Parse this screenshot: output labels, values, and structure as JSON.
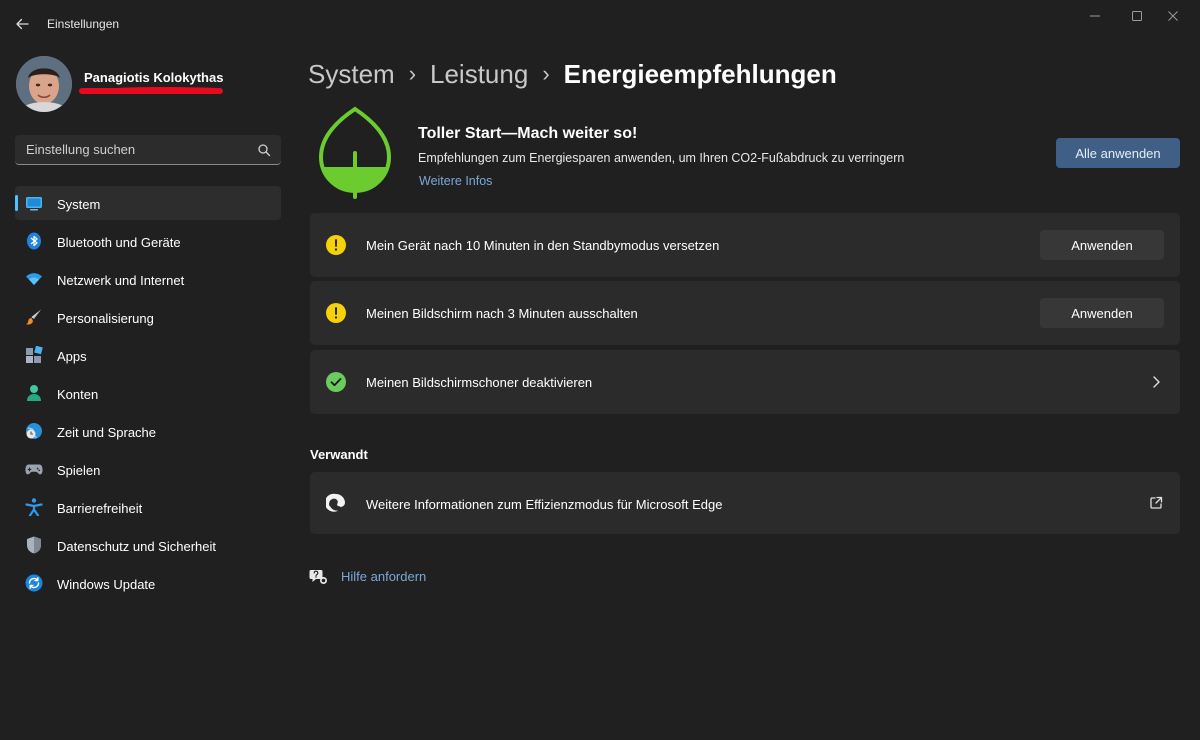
{
  "window": {
    "title": "Einstellungen"
  },
  "profile": {
    "name": "Panagiotis Kolokythas"
  },
  "search": {
    "placeholder": "Einstellung suchen"
  },
  "sidebar": {
    "items": [
      {
        "label": "System",
        "icon": "monitor-icon",
        "active": true
      },
      {
        "label": "Bluetooth und Geräte",
        "icon": "bluetooth-icon"
      },
      {
        "label": "Netzwerk und Internet",
        "icon": "wifi-icon"
      },
      {
        "label": "Personalisierung",
        "icon": "paintbrush-icon"
      },
      {
        "label": "Apps",
        "icon": "apps-icon"
      },
      {
        "label": "Konten",
        "icon": "person-icon"
      },
      {
        "label": "Zeit und Sprache",
        "icon": "globe-clock-icon"
      },
      {
        "label": "Spielen",
        "icon": "gamepad-icon"
      },
      {
        "label": "Barrierefreiheit",
        "icon": "accessibility-icon"
      },
      {
        "label": "Datenschutz und Sicherheit",
        "icon": "shield-icon"
      },
      {
        "label": "Windows Update",
        "icon": "update-icon"
      }
    ]
  },
  "breadcrumb": {
    "items": [
      "System",
      "Leistung"
    ],
    "current": "Energieempfehlungen"
  },
  "hero": {
    "title": "Toller Start—Mach weiter so!",
    "description": "Empfehlungen zum Energiesparen anwenden, um Ihren CO2-Fußabdruck zu verringern",
    "link": "Weitere Infos",
    "apply_all": "Alle anwenden",
    "accent": "#3f5f86",
    "leaf_color": "#6ccb2f"
  },
  "recommendations": [
    {
      "text": "Mein Gerät nach 10 Minuten in den Standbymodus versetzen",
      "status": "warning",
      "action": "Anwenden"
    },
    {
      "text": "Meinen Bildschirm nach 3 Minuten ausschalten",
      "status": "warning",
      "action": "Anwenden"
    },
    {
      "text": "Meinen Bildschirmschoner deaktivieren",
      "status": "done"
    }
  ],
  "status_colors": {
    "warning": "#f5d10b",
    "done": "#6ccb5f"
  },
  "related": {
    "title": "Verwandt",
    "items": [
      {
        "text": "Weitere Informationen zum Effizienzmodus für Microsoft Edge",
        "icon": "edge-icon"
      }
    ]
  },
  "help": {
    "label": "Hilfe anfordern"
  }
}
